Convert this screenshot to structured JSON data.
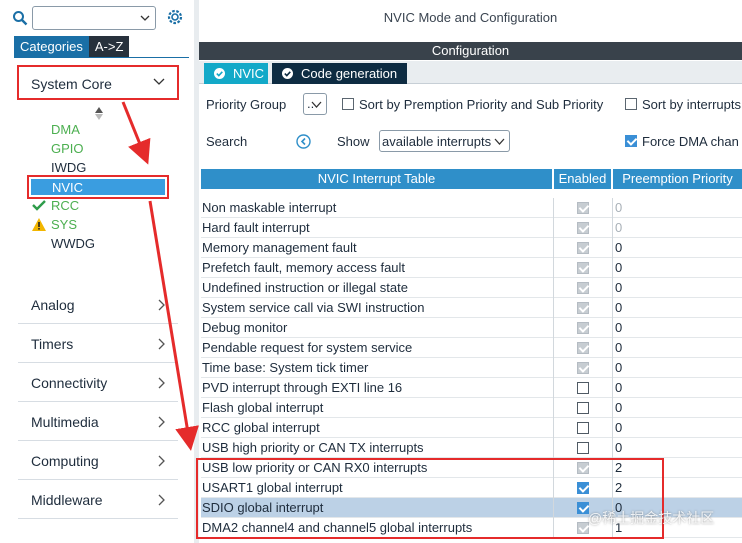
{
  "left": {
    "tabs": [
      "Categories",
      "A->Z"
    ],
    "system_core": "System Core",
    "peripherals": [
      {
        "label": "DMA",
        "status": "ok"
      },
      {
        "label": "GPIO",
        "status": "ok"
      },
      {
        "label": "IWDG",
        "status": "none"
      },
      {
        "label": "NVIC",
        "status": "selected"
      },
      {
        "label": "RCC",
        "status": "check"
      },
      {
        "label": "SYS",
        "status": "warning"
      },
      {
        "label": "WWDG",
        "status": "none"
      }
    ],
    "categories": [
      "Analog",
      "Timers",
      "Connectivity",
      "Multimedia",
      "Computing",
      "Middleware"
    ]
  },
  "right": {
    "title": "NVIC Mode and Configuration",
    "config_bar": "Configuration",
    "tabs": [
      "NVIC",
      "Code generation"
    ],
    "priority_group_label": "Priority Group",
    "priority_group_value": "..",
    "sort_premption": "Sort by Premption Priority and Sub Priority",
    "sort_interrupts": "Sort by interrupts",
    "search_label": "Search",
    "show_label": "Show",
    "show_value": "available interrupts",
    "force_dma": "Force DMA chan",
    "columns": [
      "NVIC Interrupt Table",
      "Enabled",
      "Preemption Priority"
    ],
    "rows": [
      {
        "name": "Non maskable interrupt",
        "enabled": "disabled-checked",
        "priority": "0"
      },
      {
        "name": "Hard fault interrupt",
        "enabled": "disabled-checked",
        "priority": "0"
      },
      {
        "name": "Memory management fault",
        "enabled": "disabled-checked",
        "priority": "0"
      },
      {
        "name": "Prefetch fault, memory access fault",
        "enabled": "disabled-checked",
        "priority": "0"
      },
      {
        "name": "Undefined instruction or illegal state",
        "enabled": "disabled-checked",
        "priority": "0"
      },
      {
        "name": "System service call via SWI instruction",
        "enabled": "disabled-checked",
        "priority": "0"
      },
      {
        "name": "Debug monitor",
        "enabled": "disabled-checked",
        "priority": "0"
      },
      {
        "name": "Pendable request for system service",
        "enabled": "disabled-checked",
        "priority": "0"
      },
      {
        "name": "Time base: System tick timer",
        "enabled": "disabled-checked",
        "priority": "0"
      },
      {
        "name": "PVD interrupt through EXTI line 16",
        "enabled": "unchecked",
        "priority": "0"
      },
      {
        "name": "Flash global interrupt",
        "enabled": "unchecked",
        "priority": "0"
      },
      {
        "name": "RCC global interrupt",
        "enabled": "unchecked",
        "priority": "0"
      },
      {
        "name": "USB high priority or CAN TX interrupts",
        "enabled": "unchecked",
        "priority": "0"
      },
      {
        "name": "USB low priority or CAN RX0 interrupts",
        "enabled": "disabled-checked",
        "priority": "2"
      },
      {
        "name": "USART1 global interrupt",
        "enabled": "checked",
        "priority": "2"
      },
      {
        "name": "SDIO global interrupt",
        "enabled": "checked",
        "priority": "0"
      },
      {
        "name": "DMA2 channel4 and channel5 global interrupts",
        "enabled": "disabled-checked",
        "priority": "1"
      }
    ]
  },
  "watermark": "@稀土掘金技术社区",
  "colors": {
    "accent": "#2f8fc9",
    "highlight": "#e52b2b",
    "selected": "#3a9de0",
    "ok": "#4caf50"
  }
}
